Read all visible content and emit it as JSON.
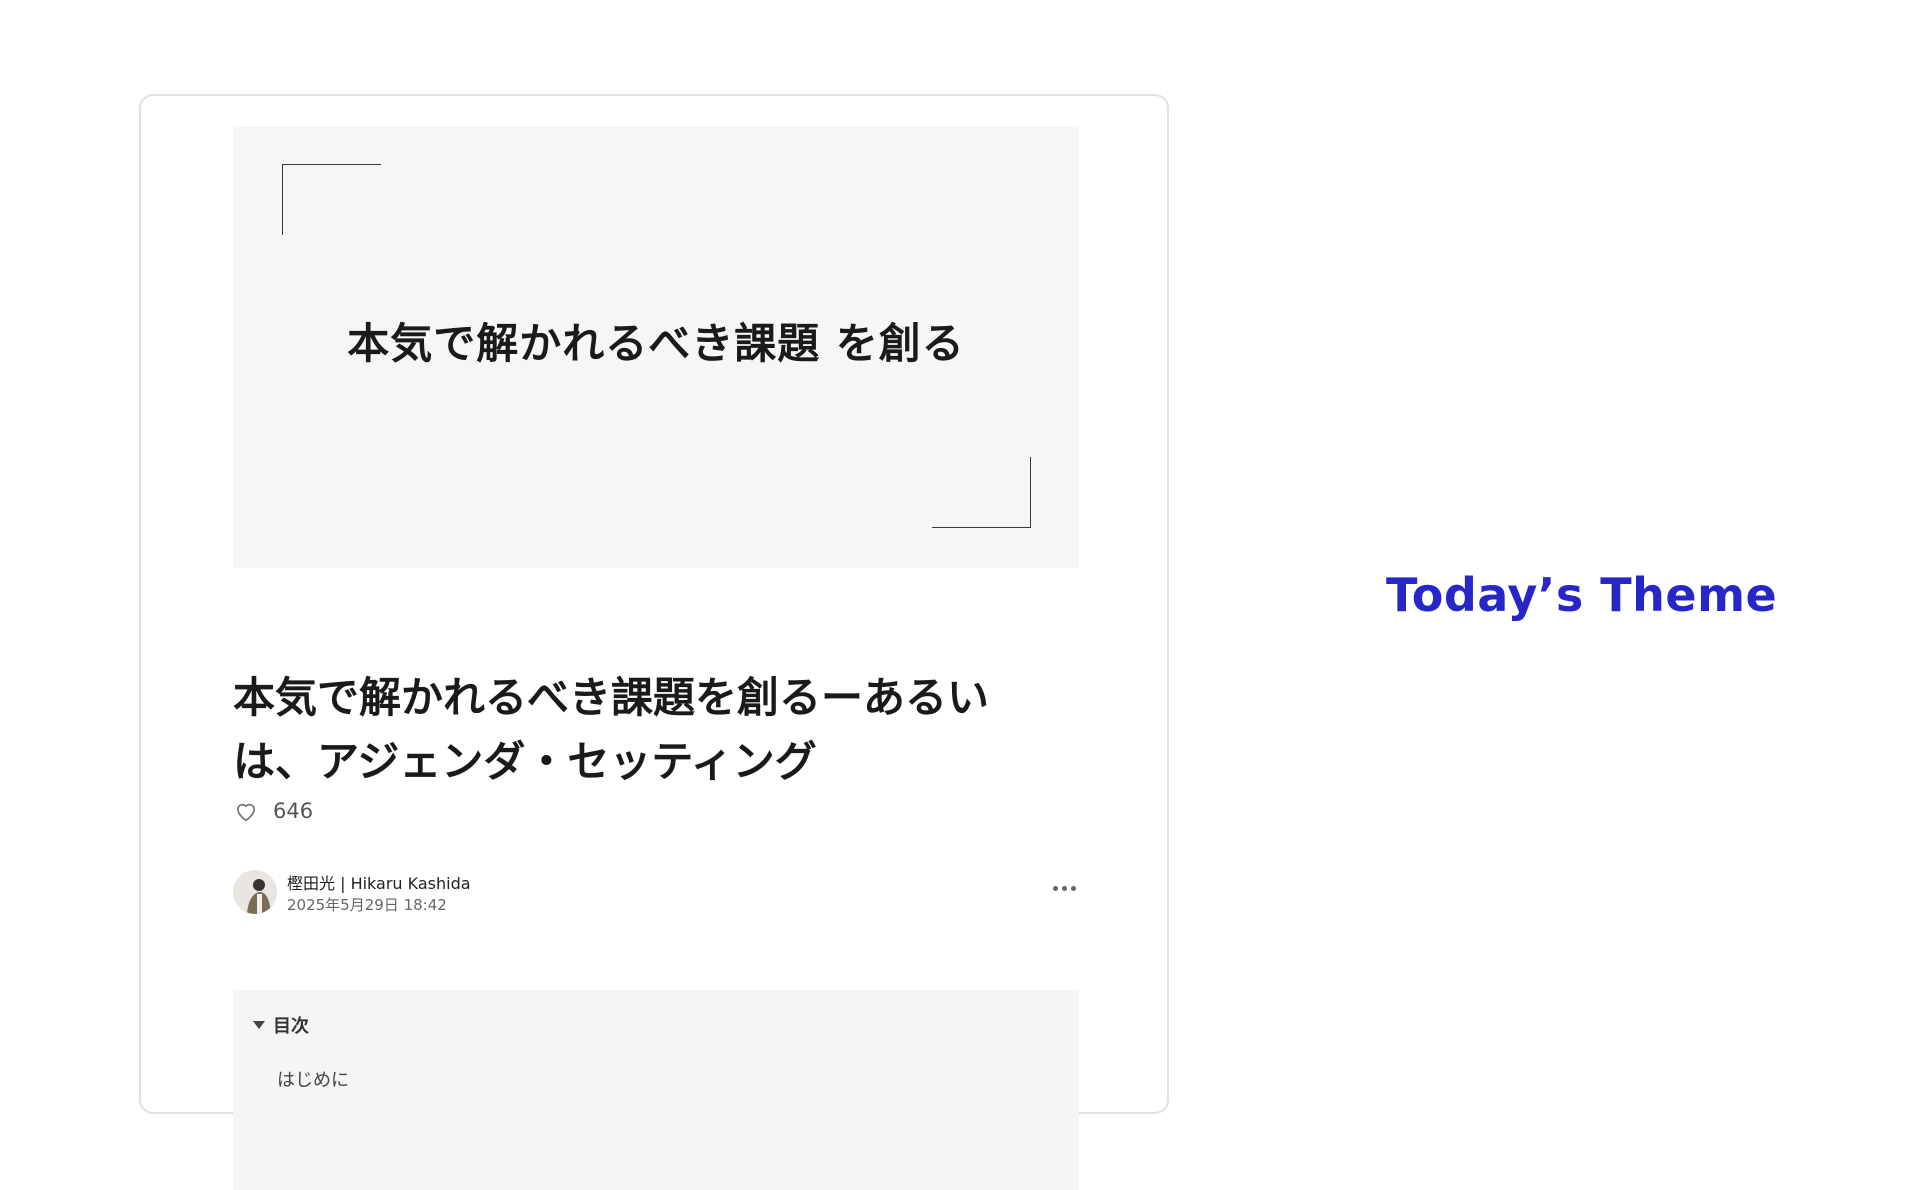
{
  "hero": {
    "title": "本気で解かれるべき課題 を創る"
  },
  "article": {
    "title": "本気で解かれるべき課題を創るーあるいは、アジェンダ・セッティング",
    "likes": "646"
  },
  "author": {
    "name": "樫田光 | Hikaru Kashida",
    "date": "2025年5月29日 18:42"
  },
  "toc": {
    "label": "目次",
    "items": [
      "はじめに"
    ]
  },
  "theme": {
    "label": "Today’s Theme",
    "color": "#2727c8"
  },
  "icons": {
    "like": "heart-icon",
    "more": "more-options-icon",
    "toggle": "caret-down-icon"
  }
}
